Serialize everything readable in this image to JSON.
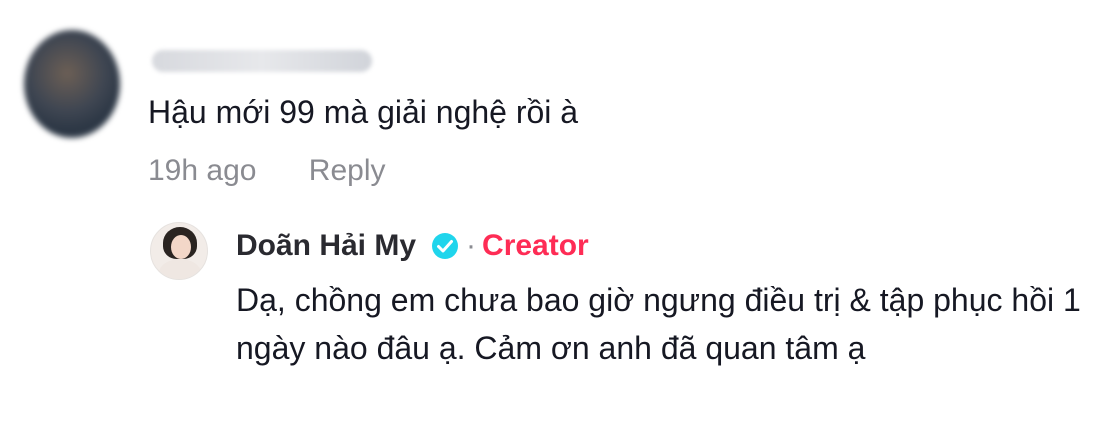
{
  "comment": {
    "avatar": "avatar-blurred",
    "username": "",
    "text": "Hậu mới 99 mà giải nghệ rồi à",
    "time": "19h ago",
    "reply_label": "Reply"
  },
  "reply": {
    "avatar": "avatar-photo",
    "name": "Doãn Hải My",
    "verified_icon": "verified-check-icon",
    "separator": "·",
    "badge": "Creator",
    "text": "Dạ, chồng em chưa bao giờ ngưng điều trị & tập phục hồi 1 ngày nào đâu ạ. Cảm ơn anh đã quan tâm ạ"
  },
  "colors": {
    "text": "#161823",
    "muted": "#8a8b91",
    "creator": "#fe2c55",
    "verified": "#20d5ec"
  }
}
